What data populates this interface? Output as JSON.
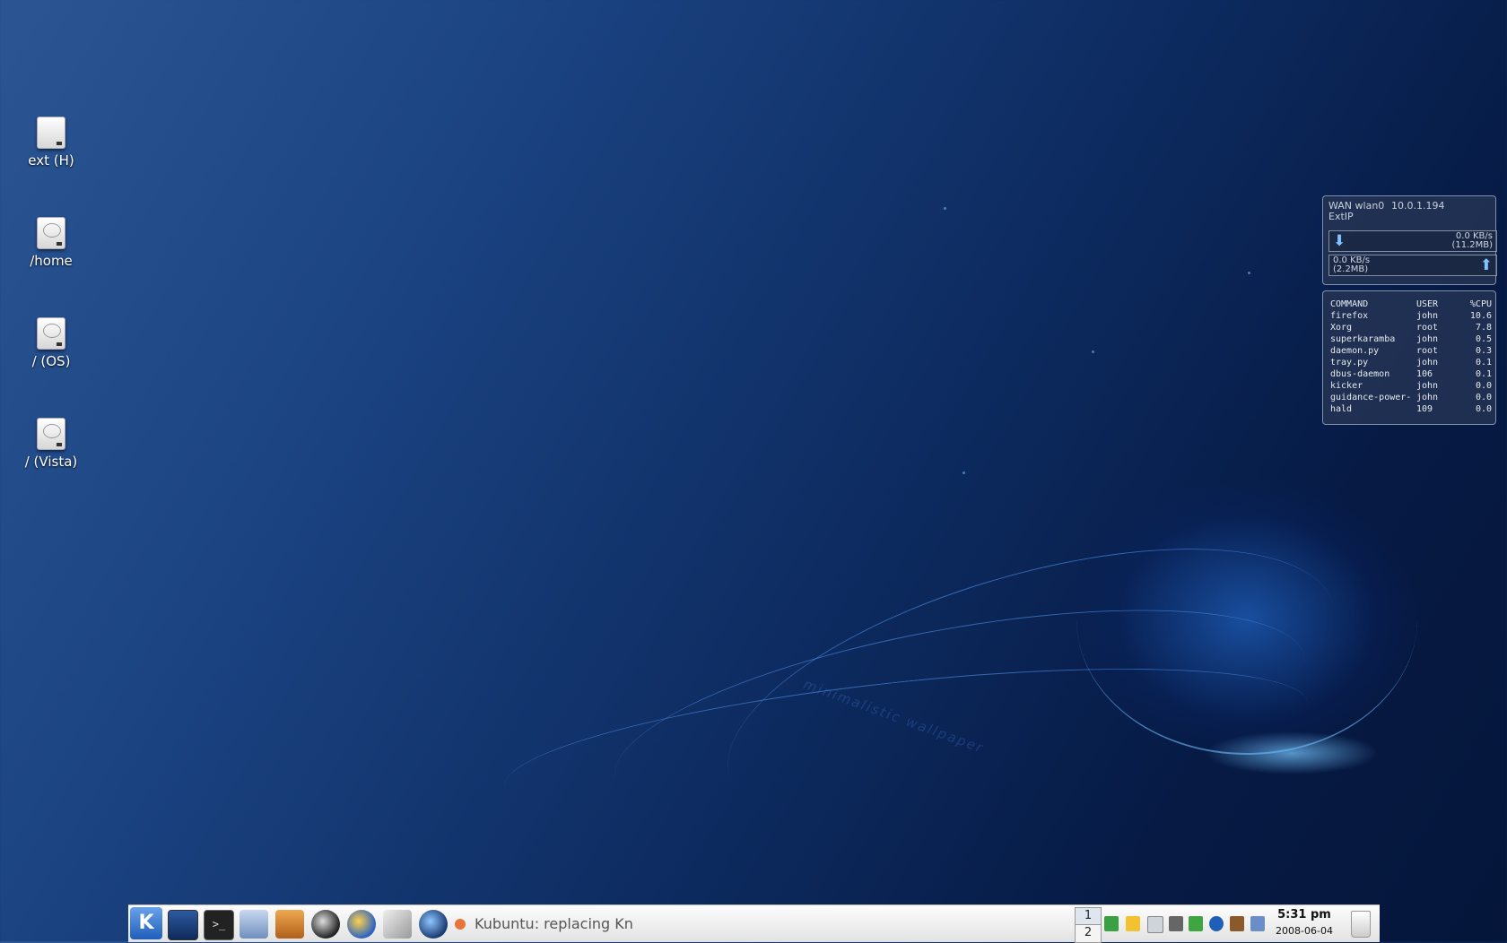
{
  "desktop": {
    "icons": [
      {
        "label": "ext (H)",
        "icon": "removable-drive-icon"
      },
      {
        "label": "/home",
        "icon": "hard-drive-icon"
      },
      {
        "label": "/ (OS)",
        "icon": "hard-drive-icon"
      },
      {
        "label": "/ (Vista)",
        "icon": "hard-drive-icon"
      }
    ],
    "wallpaper_text": "minimalistic wallpaper"
  },
  "network_widget": {
    "interface": "WAN wlan0",
    "ip": "10.0.1.194",
    "ext_label": "ExtIP",
    "download": {
      "rate": "0.0 KB/s",
      "total": "(11.2MB)"
    },
    "upload": {
      "rate": "0.0 KB/s",
      "total": "(2.2MB)"
    }
  },
  "process_widget": {
    "headers": [
      "COMMAND",
      "USER",
      "%CPU"
    ],
    "rows": [
      [
        "firefox",
        "john",
        "10.6"
      ],
      [
        "Xorg",
        "root",
        "7.8"
      ],
      [
        "superkaramba",
        "john",
        "0.5"
      ],
      [
        "daemon.py",
        "root",
        "0.3"
      ],
      [
        "tray.py",
        "john",
        "0.1"
      ],
      [
        "dbus-daemon",
        "106",
        "0.1"
      ],
      [
        "kicker",
        "john",
        "0.0"
      ],
      [
        "guidance-power-",
        "john",
        "0.0"
      ],
      [
        "hald",
        "109",
        "0.0"
      ]
    ]
  },
  "taskbar": {
    "kmenu_label": "K",
    "task_title": "Kubuntu: replacing Kn",
    "pager": [
      "1",
      "2"
    ],
    "clock_time": "5:31 pm",
    "clock_date": "2008-06-04",
    "accent": "#1f5fb8"
  }
}
